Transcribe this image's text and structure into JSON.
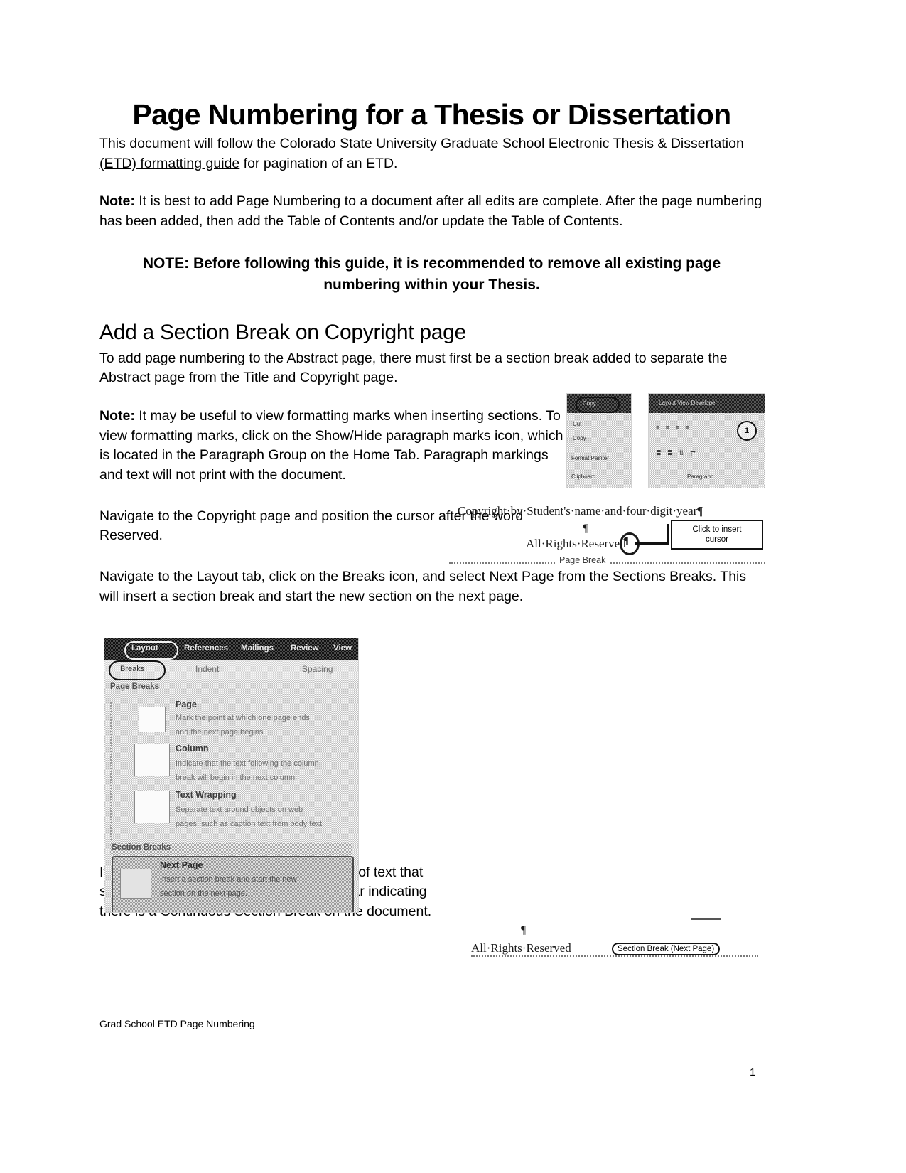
{
  "document": {
    "title": "Page Numbering for a Thesis or Dissertation",
    "intro": {
      "lead": "This document will follow the Colorado State University Graduate School ",
      "link_text": "Electronic Thesis & Dissertation (ETD) formatting guide",
      "tail": " for pagination of an ETD."
    },
    "note1": {
      "label": "Note:",
      "text": " It is best to add Page Numbering to a document after all edits are complete.  After the page numbering has been added, then add the Table of Contents and/or update the Table of Contents."
    },
    "note_emphasis": "NOTE:  Before following this guide, it is recommended to remove all existing page numbering within your Thesis.",
    "section1": {
      "heading": "Add a Section Break on Copyright page",
      "para1": "To add page numbering to the Abstract page, there must first be a section break added to separate the Abstract page from the Title and Copyright page.",
      "note2_label": "Note:",
      "note2_text": " It may be useful to view formatting marks when inserting sections.  To view formatting marks, click on the Show/Hide paragraph marks icon, which is located in the Paragraph Group on the Home Tab.  Paragraph markings and text will not print with the document.",
      "para2": "Navigate to the Copyright page and position the cursor after the word Reserved.",
      "para3": "Navigate to the Layout tab, click on the Breaks icon, and select Next Page from the Sections Breaks.  This will insert a section break and start the new section on the next page.",
      "para4": "If paragraph marks are turned on, a piece of text that says Section Break (Next page) will appear indicating there is a Continuous Section Break on the document."
    }
  },
  "figure_showhide": {
    "caption_role": "home-tab-show-hide-screenshot",
    "panel_a": {
      "titlebar_pill_label": "Copy",
      "rows": [
        "Cut",
        "Copy",
        "Format Painter"
      ],
      "group_label": "Clipboard"
    },
    "panel_b": {
      "titlebar_labels": "Layout   View   Developer",
      "highlight_badge": "1",
      "group_label": "Paragraph"
    }
  },
  "figure_copyright": {
    "line1": "Copyright·by·Student's·name·and·four·digit·year¶",
    "pilcrow": "¶",
    "line2": "All·Rights·Reserved",
    "cursor_mark": "¶",
    "callout_line1": "Click to insert",
    "callout_line2": "cursor",
    "page_break_label": "Page Break"
  },
  "figure_breaks": {
    "tabs": [
      "Layout",
      "References",
      "Mailings",
      "Review",
      "View"
    ],
    "breaks_button": "Breaks",
    "group_indent": "Indent",
    "group_spacing": "Spacing",
    "page_breaks_header": "Page Breaks",
    "items": [
      {
        "title": "Page",
        "desc_line1": "Mark the point at which one page ends",
        "desc_line2": "and the next page begins."
      },
      {
        "title": "Column",
        "desc_line1": "Indicate that the text following the column",
        "desc_line2": "break will begin in the next column."
      },
      {
        "title": "Text Wrapping",
        "desc_line1": "Separate text around objects on web",
        "desc_line2": "pages, such as caption text from body text."
      }
    ],
    "section_breaks_header": "Section Breaks",
    "selected_item": {
      "title": "Next Page",
      "desc_line1": "Insert a section break and start the new",
      "desc_line2": "section on the next page."
    }
  },
  "figure_sectionbreak": {
    "pilcrow": "¶",
    "text_left": "All·Rights·Reserved",
    "marker": "Section Break (Next Page)"
  },
  "footer": {
    "note": "Grad School ETD Page Numbering",
    "page_number": "1"
  },
  "colors": {
    "text": "#000000",
    "muted": "#6e6e6e",
    "page_bg": "#ffffff"
  }
}
